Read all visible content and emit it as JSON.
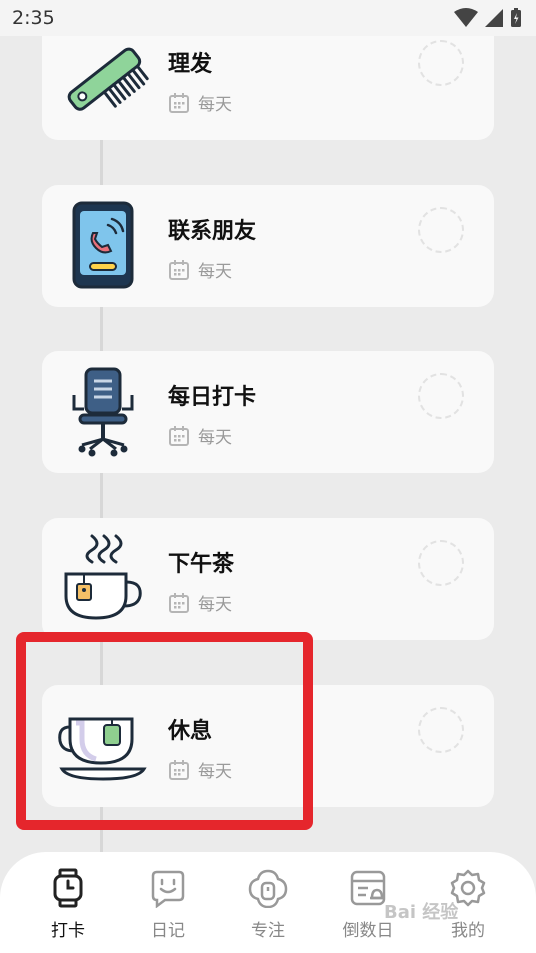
{
  "status_bar": {
    "time": "2:35"
  },
  "tasks": [
    {
      "title": "理发",
      "frequency": "每天",
      "icon": "comb-icon"
    },
    {
      "title": "联系朋友",
      "frequency": "每天",
      "icon": "phone-call-icon"
    },
    {
      "title": "每日打卡",
      "frequency": "每天",
      "icon": "office-chair-icon"
    },
    {
      "title": "下午茶",
      "frequency": "每天",
      "icon": "tea-cup-steam-icon"
    },
    {
      "title": "休息",
      "frequency": "每天",
      "icon": "tea-cup-icon"
    }
  ],
  "nav": {
    "items": [
      {
        "label": "打卡",
        "icon": "watch-clock-icon",
        "active": true
      },
      {
        "label": "日记",
        "icon": "smile-note-icon",
        "active": false
      },
      {
        "label": "专注",
        "icon": "focus-timer-icon",
        "active": false
      },
      {
        "label": "倒数日",
        "icon": "calendar-countdown-icon",
        "active": false
      },
      {
        "label": "我的",
        "icon": "gear-icon",
        "active": false
      }
    ]
  },
  "watermark": "Bai 经验",
  "colors": {
    "highlight": "#e5262c",
    "background": "#ebebeb",
    "card": "#f9f9f9"
  }
}
